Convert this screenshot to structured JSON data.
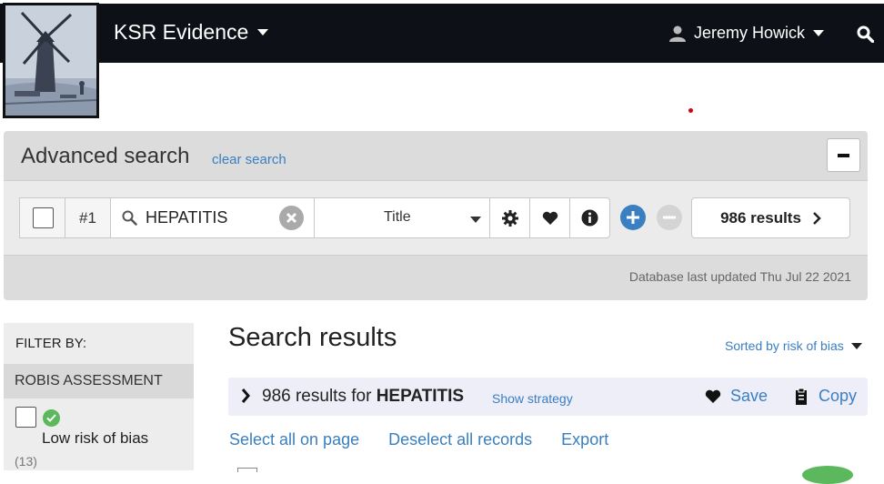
{
  "navbar": {
    "brand": "KSR Evidence",
    "user_name": "Jeremy Howick",
    "logo_icon": "windmill-painting-logo",
    "search_icon": "search-icon"
  },
  "advanced_search": {
    "title": "Advanced search",
    "clear_label": "clear search",
    "query": {
      "number": "#1",
      "term": "HEPATITIS",
      "field": "Title",
      "results_label": "986 results"
    },
    "db_updated": "Database last updated Thu Jul 22 2021"
  },
  "sidebar": {
    "filter_by": "FILTER BY:",
    "section_title": "ROBIS ASSESSMENT",
    "option_label": "Low risk of bias",
    "option_count": "(13)"
  },
  "results": {
    "title": "Search results",
    "sort_label": "Sorted by risk of bias",
    "summary_prefix": "986 results for",
    "summary_term": "HEPATITIS",
    "show_strategy": "Show strategy",
    "save_label": "Save",
    "copy_label": "Copy",
    "actions": [
      "Select all on page",
      "Deselect all records",
      "Export"
    ]
  },
  "colors": {
    "navbar": "#0d1117",
    "link": "#3a7fc1",
    "panel": "#dcdcdc",
    "success": "#5cb85c"
  }
}
